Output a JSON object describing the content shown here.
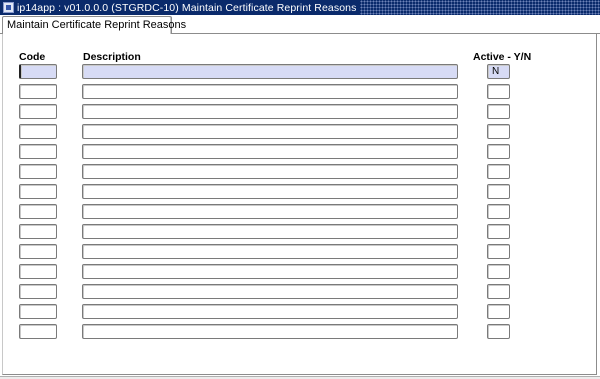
{
  "window": {
    "title": "ip14app : v01.0.0.0 (STGRDC-10) Maintain Certificate Reprint Reasons"
  },
  "tabs": [
    {
      "label": "Maintain Certificate Reprint Reasons"
    }
  ],
  "columns": {
    "code": "Code",
    "description": "Description",
    "active": "Active - Y/N"
  },
  "rows": [
    {
      "code": "",
      "description": "",
      "active": "N"
    },
    {
      "code": "",
      "description": "",
      "active": ""
    },
    {
      "code": "",
      "description": "",
      "active": ""
    },
    {
      "code": "",
      "description": "",
      "active": ""
    },
    {
      "code": "",
      "description": "",
      "active": ""
    },
    {
      "code": "",
      "description": "",
      "active": ""
    },
    {
      "code": "",
      "description": "",
      "active": ""
    },
    {
      "code": "",
      "description": "",
      "active": ""
    },
    {
      "code": "",
      "description": "",
      "active": ""
    },
    {
      "code": "",
      "description": "",
      "active": ""
    },
    {
      "code": "",
      "description": "",
      "active": ""
    },
    {
      "code": "",
      "description": "",
      "active": ""
    },
    {
      "code": "",
      "description": "",
      "active": ""
    },
    {
      "code": "",
      "description": "",
      "active": ""
    }
  ]
}
